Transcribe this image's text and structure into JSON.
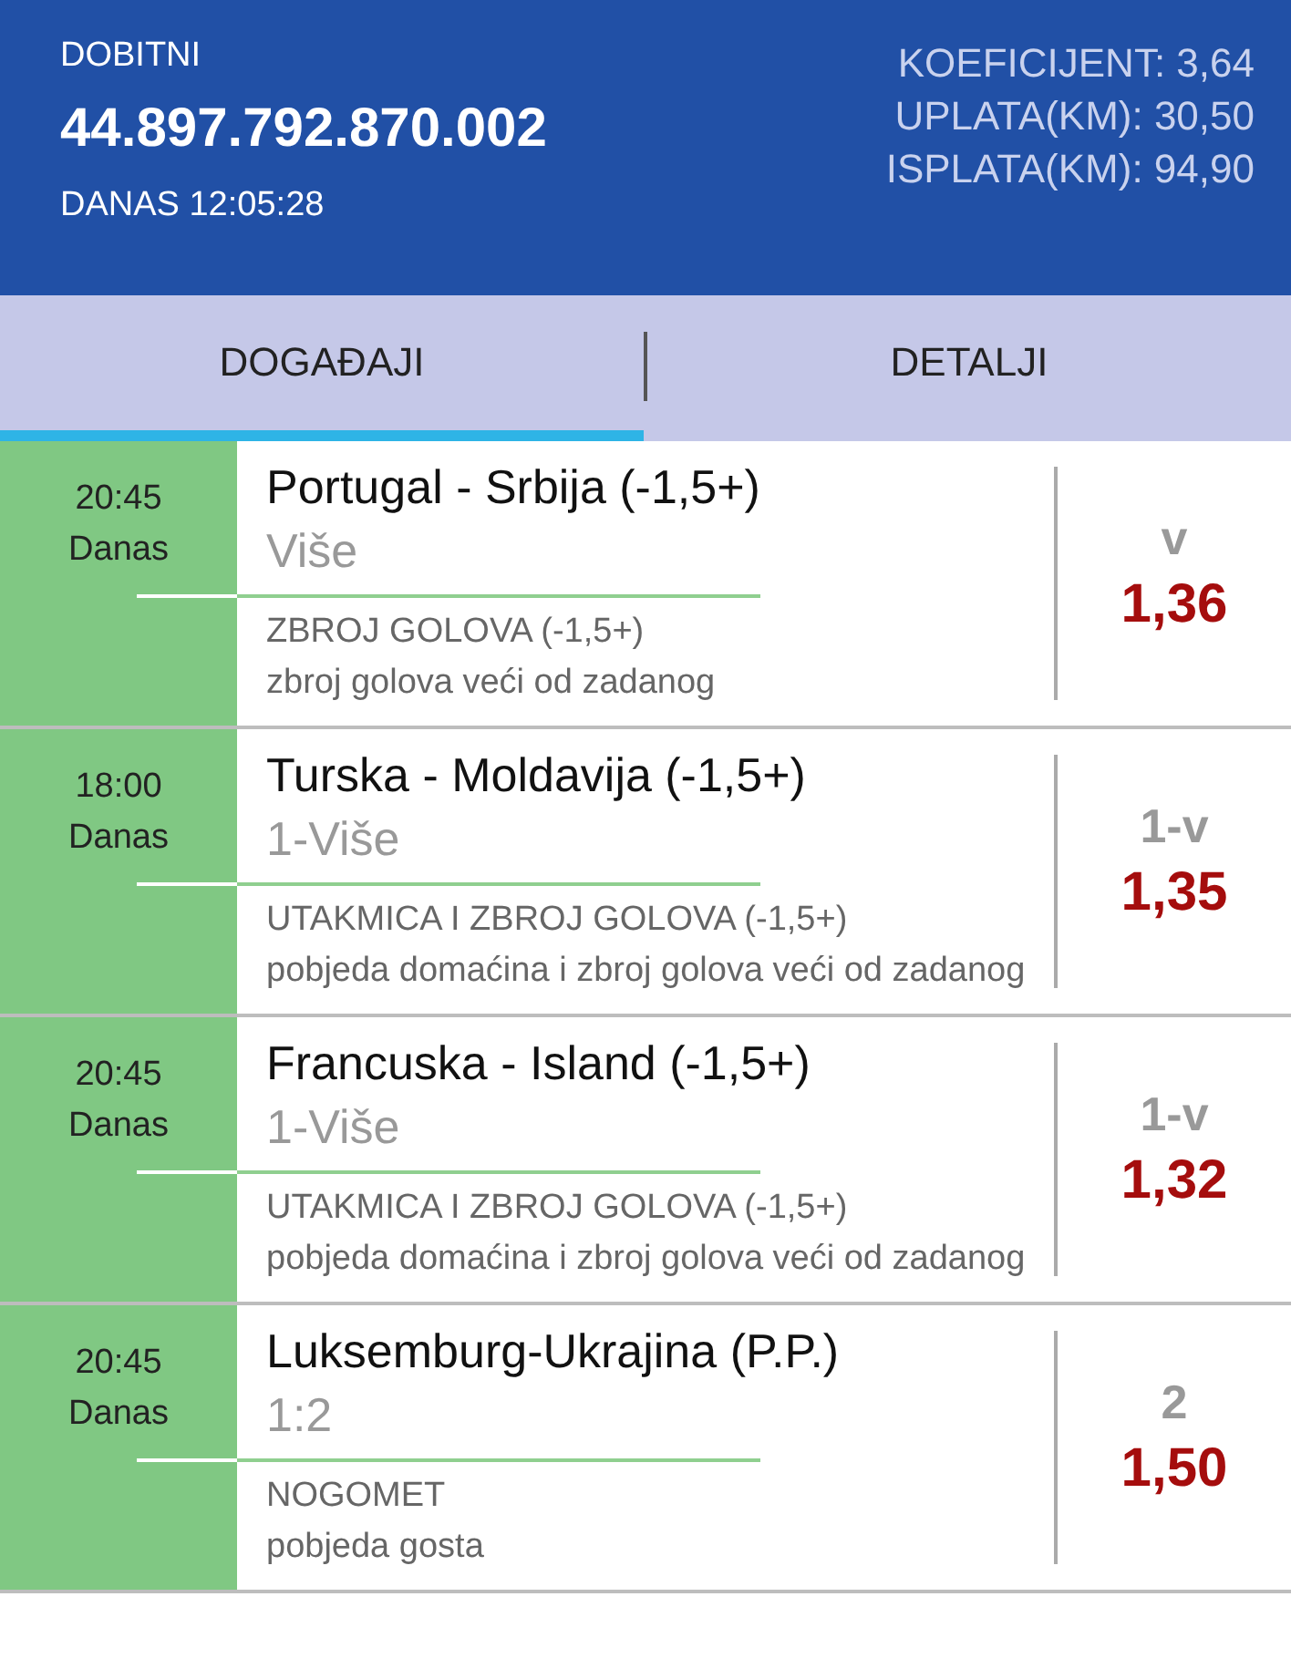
{
  "header": {
    "status": "DOBITNI",
    "ticket_number": "44.897.792.870.002",
    "date_time": "DANAS 12:05:28",
    "totals": [
      "KOEFICIJENT: 3,64",
      "UPLATA(KM): 30,50",
      "ISPLATA(KM): 94,90"
    ]
  },
  "tabs": [
    {
      "label": "DOGAĐAJI",
      "selected": true
    },
    {
      "label": "DETALJI",
      "selected": false
    }
  ],
  "events": [
    {
      "time": "20:45",
      "day": "Danas",
      "match": "Portugal - Srbija (-1,5+)",
      "pick": "Više",
      "market": "ZBROJ GOLOVA (-1,5+)",
      "description": "zbroj golova veći od zadanog",
      "tip": "v",
      "odd": "1,36"
    },
    {
      "time": "18:00",
      "day": "Danas",
      "match": "Turska - Moldavija (-1,5+)",
      "pick": "1-Više",
      "market": "UTAKMICA I ZBROJ GOLOVA (-1,5+)",
      "description": "pobjeda domaćina i zbroj golova veći od zadanog",
      "tip": "1-v",
      "odd": "1,35"
    },
    {
      "time": "20:45",
      "day": "Danas",
      "match": "Francuska - Island (-1,5+)",
      "pick": "1-Više",
      "market": "UTAKMICA I ZBROJ GOLOVA (-1,5+)",
      "description": "pobjeda domaćina i zbroj golova veći od zadanog",
      "tip": "1-v",
      "odd": "1,32"
    },
    {
      "time": "20:45",
      "day": "Danas",
      "match": "Luksemburg-Ukrajina (P.P.)",
      "pick": "1:2",
      "market": "NOGOMET",
      "description": "pobjeda gosta",
      "tip": "2",
      "odd": "1,50"
    }
  ]
}
